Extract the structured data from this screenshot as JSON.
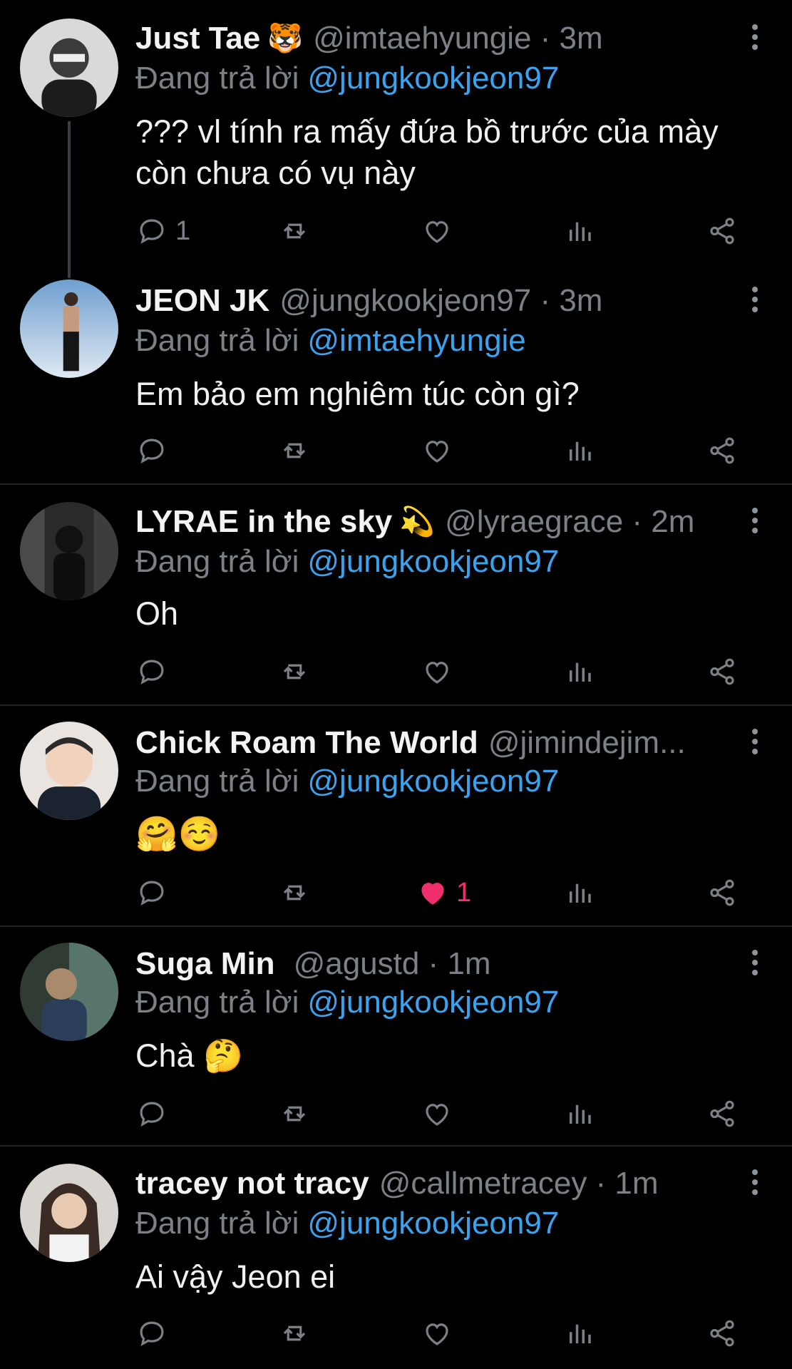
{
  "reply_prefix": "Đang trả lời",
  "colors": {
    "background": "#000000",
    "accent": "#3aa3f0",
    "like": "#f0306e",
    "muted": "#7b8187"
  },
  "tweets": [
    {
      "name": "Just Tae",
      "name_emoji": "🐯",
      "handle": "@imtaehyungie · 3m",
      "reply_to": "@jungkookjeon97",
      "text_lines": [
        "??? vl tính ra mấy đứa bồ trước của mày",
        "còn chưa có vụ này"
      ],
      "reply_count": "1",
      "like_count": "",
      "liked": false
    },
    {
      "name": "JEON JK",
      "name_emoji": "",
      "handle": "@jungkookjeon97 · 3m",
      "reply_to": "@imtaehyungie",
      "text_lines": [
        "Em bảo em nghiêm túc còn gì?"
      ],
      "reply_count": "",
      "like_count": "",
      "liked": false
    },
    {
      "name": "LYRAE in the sky",
      "name_emoji": "💫",
      "handle": "@lyraegrace · 2m",
      "reply_to": "@jungkookjeon97",
      "text_lines": [
        "Oh"
      ],
      "reply_count": "",
      "like_count": "",
      "liked": false
    },
    {
      "name": "Chick Roam The World",
      "name_emoji": "",
      "handle": "@jimindejim...",
      "reply_to": "@jungkookjeon97",
      "text_lines": [
        "🤗☺️"
      ],
      "reply_count": "",
      "like_count": "1",
      "liked": true
    },
    {
      "name": "Suga Min",
      "name_emoji": "",
      "handle": "@agustd · 1m",
      "reply_to": "@jungkookjeon97",
      "text_lines": [
        "Chà 🤔"
      ],
      "reply_count": "",
      "like_count": "",
      "liked": false
    },
    {
      "name": "tracey not tracy",
      "name_emoji": "",
      "handle": "@callmetracey · 1m",
      "reply_to": "@jungkookjeon97",
      "text_lines": [
        "Ai vậy Jeon ei"
      ],
      "reply_count": "",
      "like_count": "",
      "liked": false
    }
  ],
  "icons": [
    "reply-icon",
    "retweet-icon",
    "like-icon",
    "views-icon",
    "share-icon",
    "more-icon"
  ]
}
